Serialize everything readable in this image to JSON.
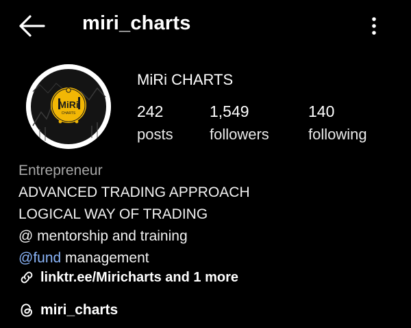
{
  "header": {
    "username": "miri_charts",
    "back_icon": "arrow-left-icon",
    "menu_icon": "more-vertical-icon"
  },
  "profile": {
    "display_name": "MiRi CHARTS",
    "avatar_text": "MiRi",
    "avatar_subtext": "CHARTS",
    "stats": {
      "posts": {
        "value": "242",
        "label": "posts"
      },
      "followers": {
        "value": "1,549",
        "label": "followers"
      },
      "following": {
        "value": "140",
        "label": "following"
      }
    }
  },
  "bio": {
    "category": "Entrepreneur",
    "line1": "ADVANCED TRADING APPROACH",
    "line2": "LOGICAL WAY OF TRADING",
    "line3": "@ mentorship and training",
    "line4_mention": "@fund",
    "line4_rest": " management"
  },
  "links": {
    "text": "linktr.ee/Miricharts and 1 more",
    "icon": "link-icon"
  },
  "threads": {
    "handle": "miri_charts",
    "icon": "threads-icon"
  },
  "colors": {
    "background": "#000000",
    "text": "#f5f5f5",
    "category": "#a8a8a8",
    "mention": "#8ab4f8",
    "avatar_accent": "#f2b705"
  }
}
